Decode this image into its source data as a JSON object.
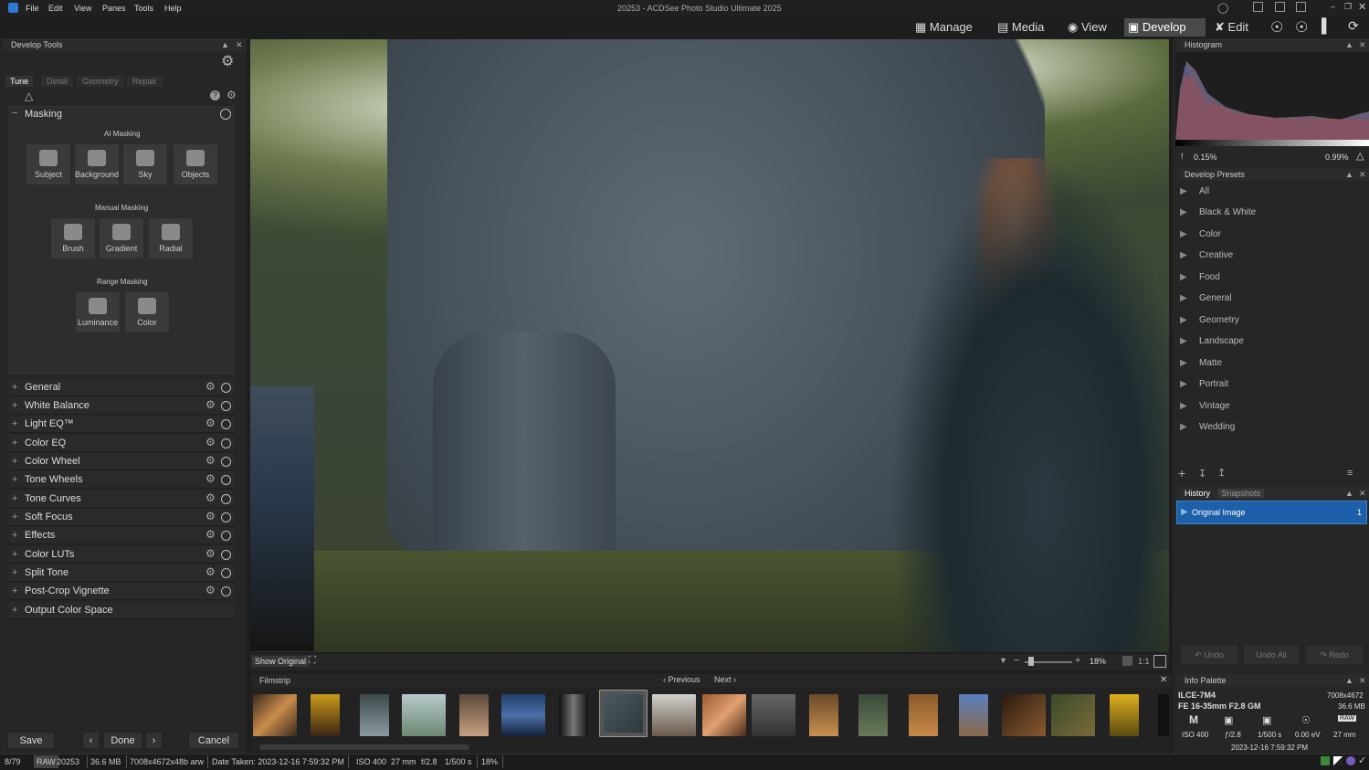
{
  "menu": {
    "file": "File",
    "edit": "Edit",
    "view": "View",
    "panes": "Panes",
    "tools": "Tools",
    "help": "Help"
  },
  "window_title": "20253 - ACDSee Photo Studio Ultimate 2025",
  "modes": {
    "manage": "Manage",
    "media": "Media",
    "view": "View",
    "develop": "Develop",
    "edit": "Edit"
  },
  "develop_tools": {
    "title": "Develop Tools",
    "tabs": [
      "Tune",
      "Detail",
      "Geometry",
      "Repair"
    ],
    "masking": {
      "title": "Masking",
      "ai_label": "AI Masking",
      "ai": [
        "Subject",
        "Background",
        "Sky",
        "Objects"
      ],
      "manual_label": "Manual Masking",
      "manual": [
        "Brush",
        "Gradient",
        "Radial"
      ],
      "range_label": "Range Masking",
      "range": [
        "Luminance",
        "Color"
      ]
    },
    "groups": [
      "General",
      "White Balance",
      "Light EQ™",
      "Color EQ",
      "Color Wheel",
      "Tone Wheels",
      "Tone Curves",
      "Soft Focus",
      "Effects",
      "Color LUTs",
      "Split Tone",
      "Post-Crop Vignette",
      "Output Color Space"
    ]
  },
  "buttons": {
    "save": "Save",
    "done": "Done",
    "cancel": "Cancel",
    "prev_arrow": "‹",
    "next_arrow": "›"
  },
  "viewer": {
    "show_original": "Show Original",
    "zoom": "18%",
    "ratio": "1:1"
  },
  "filmstrip": {
    "title": "Filmstrip",
    "previous": "Previous",
    "next": "Next"
  },
  "histogram": {
    "title": "Histogram",
    "left": "0.15%",
    "right": "0.99%"
  },
  "presets": {
    "title": "Develop Presets",
    "items": [
      "All",
      "Black & White",
      "Color",
      "Creative",
      "Food",
      "General",
      "Geometry",
      "Landscape",
      "Matte",
      "Portrait",
      "Vintage",
      "Wedding"
    ]
  },
  "history": {
    "tab1": "History",
    "tab2": "Snapshots",
    "item": "Original Image",
    "item_num": "1",
    "undo": "Undo",
    "undo_all": "Undo All",
    "redo": "Redo"
  },
  "info": {
    "title": "Info Palette",
    "camera": "ILCE-7M4",
    "dims": "7008x4672",
    "lens": "FE 16-35mm F2.8 GM",
    "size": "36.6 MB",
    "mode": "M",
    "iso": "ISO 400",
    "fstop": "ƒ/2.8",
    "shutter": "1/500 s",
    "ev": "0.00 eV",
    "focal": "27 mm",
    "raw": "RAW",
    "date": "2023-12-16 7:59:32 PM"
  },
  "status": {
    "index": "8/79",
    "raw": "RAW",
    "name": "20253",
    "size": "36.6 MB",
    "dims": "7008x4672x48b arw",
    "date": "Date Taken: 2023-12-16 7:59:32 PM",
    "iso": "ISO 400",
    "focal": "27 mm",
    "fstop": "f/2.8",
    "shutter": "1/500 s",
    "zoom": "18%"
  }
}
